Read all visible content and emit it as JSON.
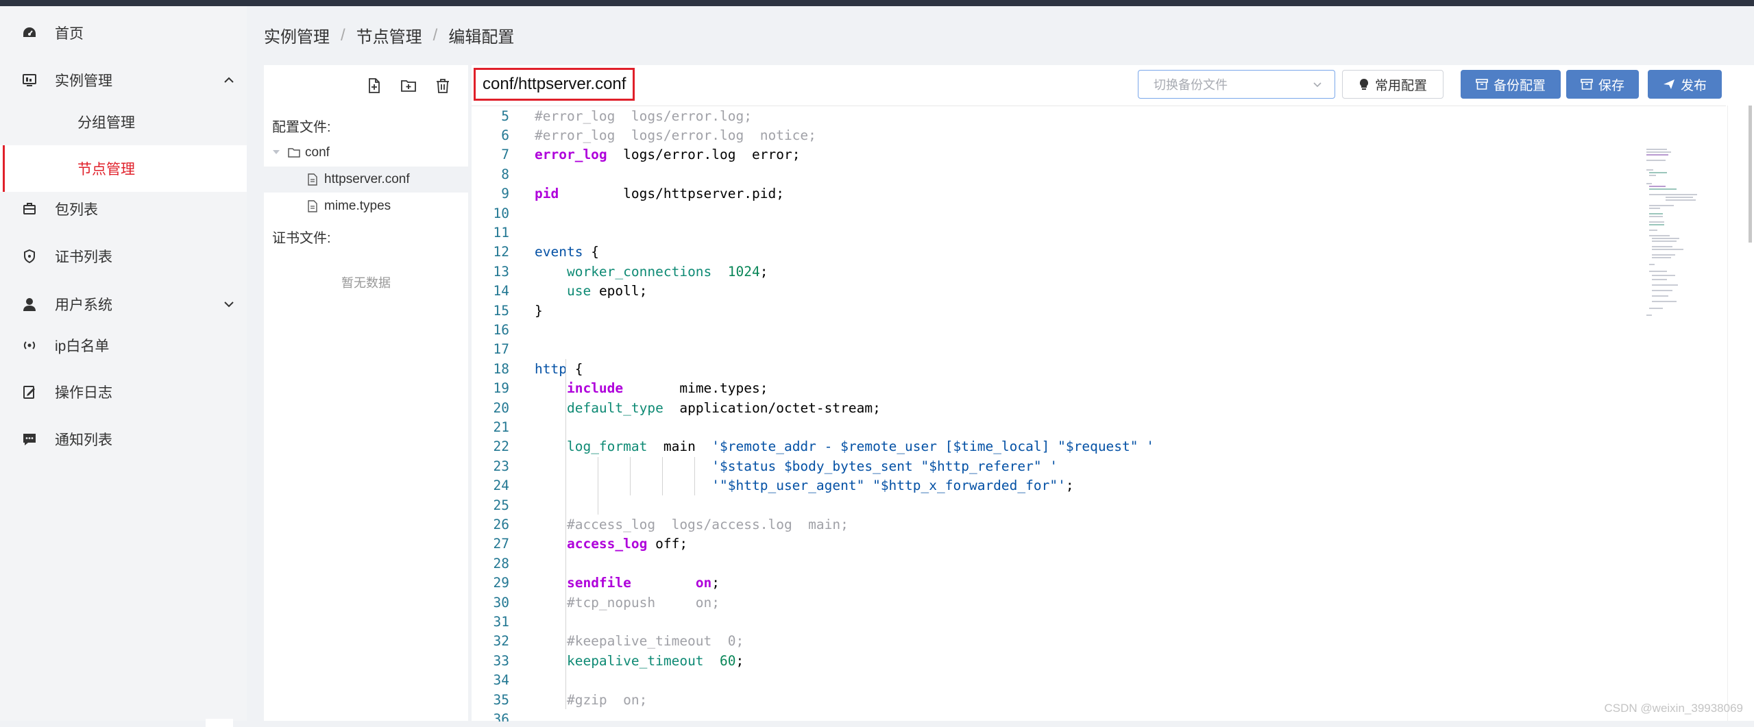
{
  "sidebar": {
    "items": [
      {
        "label": "首页",
        "icon": "dashboard-icon"
      },
      {
        "label": "实例管理",
        "icon": "monitor-icon",
        "expanded": true
      },
      {
        "label": "分组管理",
        "sub": true
      },
      {
        "label": "节点管理",
        "sub": true,
        "active": true
      },
      {
        "label": "包列表",
        "icon": "package-icon"
      },
      {
        "label": "证书列表",
        "icon": "shield-icon"
      },
      {
        "label": "用户系统",
        "icon": "user-icon",
        "expanded": false
      },
      {
        "label": "ip白名单",
        "icon": "broadcast-icon"
      },
      {
        "label": "操作日志",
        "icon": "edit-log-icon"
      },
      {
        "label": "通知列表",
        "icon": "message-icon"
      }
    ]
  },
  "breadcrumb": [
    "实例管理",
    "节点管理",
    "编辑配置"
  ],
  "file_panel": {
    "config_label": "配置文件:",
    "cert_label": "证书文件:",
    "empty_text": "暂无数据",
    "folder": "conf",
    "files": [
      "httpserver.conf",
      "mime.types"
    ],
    "selected_file": "httpserver.conf"
  },
  "editor": {
    "filename": "conf/httpserver.conf",
    "backup_placeholder": "切换备份文件",
    "common_config_label": "常用配置",
    "backup_config_label": "备份配置",
    "save_label": "保存",
    "publish_label": "发布",
    "lines": [
      {
        "n": "5",
        "text": "#error_log  logs/error.log;"
      },
      {
        "n": "6",
        "text": "#error_log  logs/error.log  notice;"
      },
      {
        "n": "7",
        "text": "error_log  logs/error.log  error;"
      },
      {
        "n": "8",
        "text": ""
      },
      {
        "n": "9",
        "text": "pid        logs/httpserver.pid;"
      },
      {
        "n": "10",
        "text": ""
      },
      {
        "n": "11",
        "text": ""
      },
      {
        "n": "12",
        "text": "events {"
      },
      {
        "n": "13",
        "text": "    worker_connections  1024;"
      },
      {
        "n": "14",
        "text": "    use epoll;"
      },
      {
        "n": "15",
        "text": "}"
      },
      {
        "n": "16",
        "text": ""
      },
      {
        "n": "17",
        "text": ""
      },
      {
        "n": "18",
        "text": "http {"
      },
      {
        "n": "19",
        "text": "    include       mime.types;"
      },
      {
        "n": "20",
        "text": "    default_type  application/octet-stream;"
      },
      {
        "n": "21",
        "text": ""
      },
      {
        "n": "22",
        "text": "    log_format  main  '$remote_addr - $remote_user [$time_local] \"$request\" '"
      },
      {
        "n": "23",
        "text": "                      '$status $body_bytes_sent \"$http_referer\" '"
      },
      {
        "n": "24",
        "text": "                      '\"$http_user_agent\" \"$http_x_forwarded_for\"';"
      },
      {
        "n": "25",
        "text": ""
      },
      {
        "n": "26",
        "text": "    #access_log  logs/access.log  main;"
      },
      {
        "n": "27",
        "text": "    access_log off;"
      },
      {
        "n": "28",
        "text": ""
      },
      {
        "n": "29",
        "text": "    sendfile        on;"
      },
      {
        "n": "30",
        "text": "    #tcp_nopush     on;"
      },
      {
        "n": "31",
        "text": ""
      },
      {
        "n": "32",
        "text": "    #keepalive_timeout  0;"
      },
      {
        "n": "33",
        "text": "    keepalive_timeout  60;"
      },
      {
        "n": "34",
        "text": ""
      },
      {
        "n": "35",
        "text": "    #gzip  on;"
      },
      {
        "n": "36",
        "text": ""
      }
    ]
  },
  "watermark": "CSDN @weixin_39938069",
  "colors": {
    "accent_red": "#e0202a",
    "primary_blue": "#4f7fc6",
    "topbar": "#2d3441"
  }
}
